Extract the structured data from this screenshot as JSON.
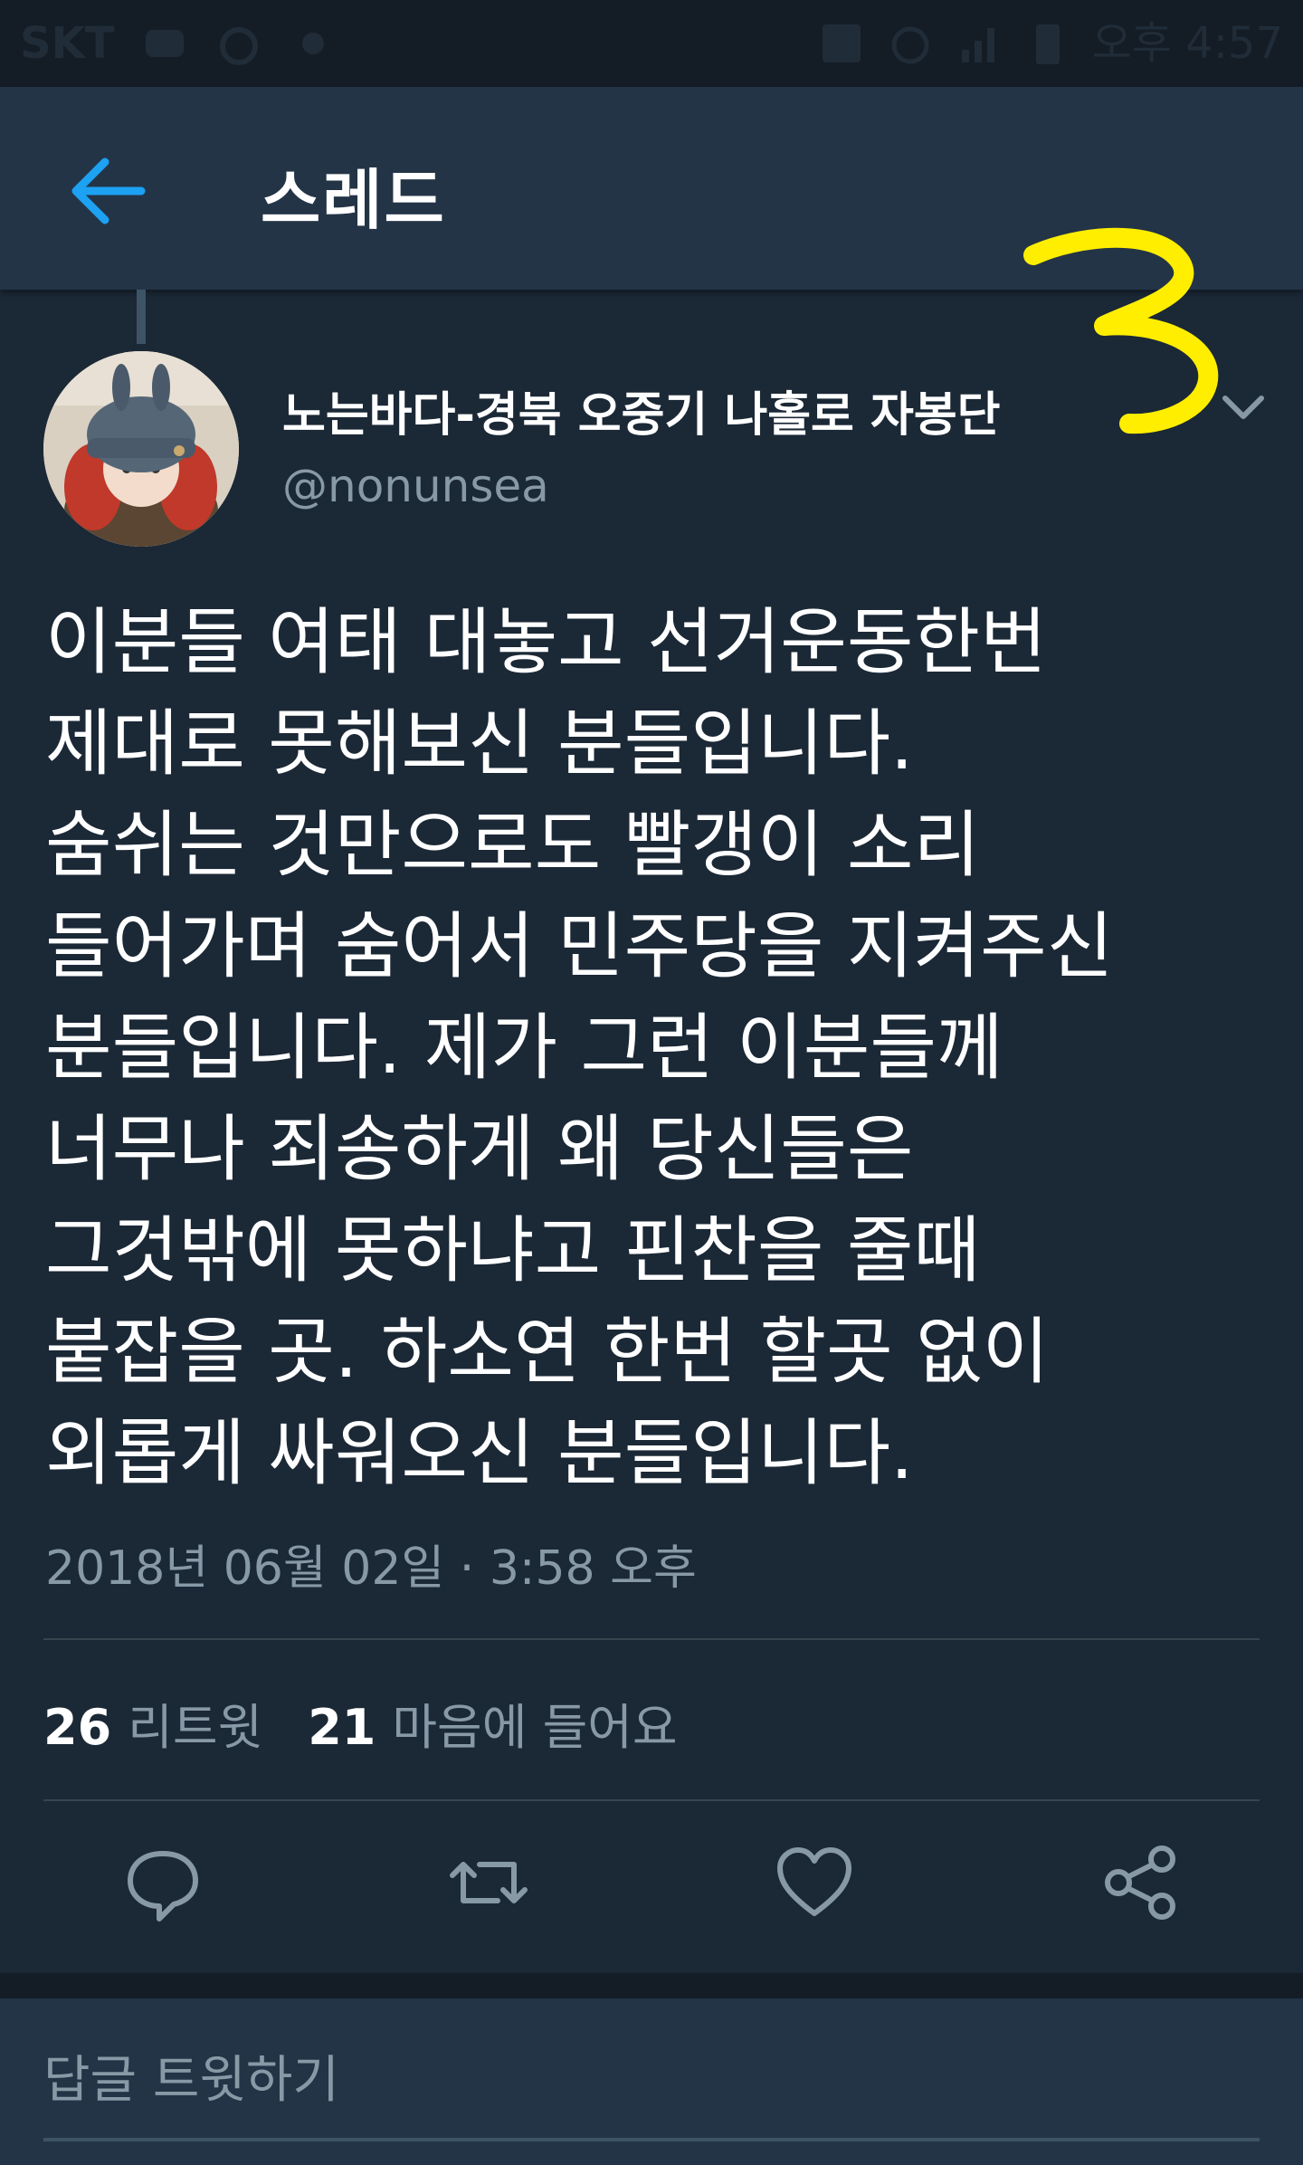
{
  "status_bar": {
    "carrier": "SKT",
    "time": "오후 4:57"
  },
  "app_bar": {
    "title": "스레드"
  },
  "tweet": {
    "display_name": "노는바다-경북 오중기 나홀로 자봉단",
    "handle": "@nonunsea",
    "text_lines": [
      "이분들 여태 대놓고 선거운동한번",
      "제대로 못해보신 분들입니다.",
      "숨쉬는 것만으로도 빨갱이 소리",
      "들어가며 숨어서 민주당을 지켜주신",
      "분들입니다. 제가 그런 이분들께",
      "너무나 죄송하게 왜 당신들은",
      "그것밖에 못하냐고 핀찬을 줄때",
      "붙잡을 곳. 하소연 한번 할곳 없이",
      "외롭게 싸워오신 분들입니다."
    ],
    "timestamp": "2018년 06월 02일 · 3:58 오후",
    "retweet_count": "26",
    "retweet_label": "리트윗",
    "like_count": "21",
    "like_label": "마음에 들어요"
  },
  "reply": {
    "placeholder": "답글 트윗하기"
  },
  "icons": {
    "back": "arrow-left-icon",
    "caret": "chevron-down-icon",
    "reply": "comment-icon",
    "retweet": "retweet-icon",
    "like": "heart-icon",
    "share": "share-icon"
  },
  "colors": {
    "background": "#1b2836",
    "app_bar": "#243447",
    "accent": "#1da1f2",
    "secondary_text": "#8899a6",
    "annotation": "#ffee00"
  }
}
